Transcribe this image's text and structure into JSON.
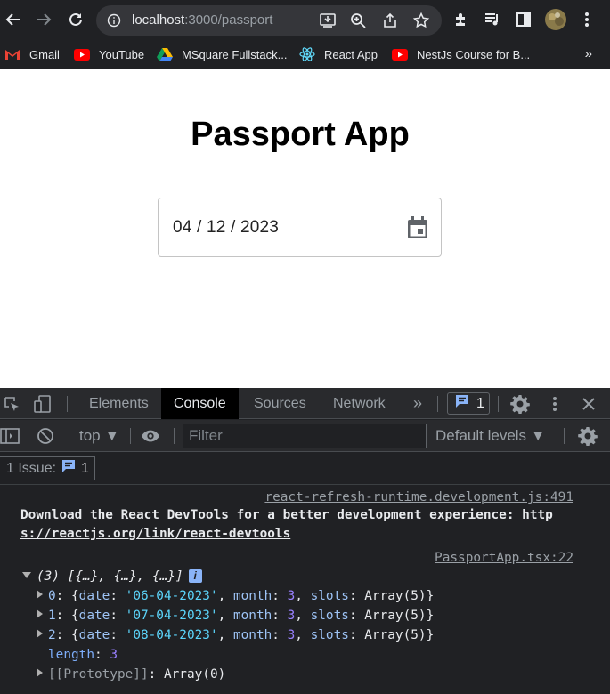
{
  "browser": {
    "url_host": "localhost",
    "url_path": ":3000/passport",
    "bookmarks": [
      {
        "label": "Gmail",
        "icon": "gmail-icon"
      },
      {
        "label": "YouTube",
        "icon": "youtube-icon"
      },
      {
        "label": "MSquare Fullstack...",
        "icon": "drive-icon"
      },
      {
        "label": "React App",
        "icon": "react-icon"
      },
      {
        "label": "NestJs Course for B...",
        "icon": "youtube-icon"
      }
    ],
    "bookmarks_more": "»"
  },
  "page": {
    "title": "Passport App",
    "date_value": "04 / 12 / 2023"
  },
  "devtools": {
    "tabs": [
      "Elements",
      "Console",
      "Sources",
      "Network"
    ],
    "active_tab": "Console",
    "more_tabs": "»",
    "issues_count": "1",
    "context": "top ▼",
    "filter_placeholder": "Filter",
    "levels": "Default levels ▼",
    "issue_label": "1 Issue:",
    "issue_count": "1",
    "console": {
      "msg1_source": "react-refresh-runtime.development.js:491",
      "msg1_text_a": "Download the React DevTools for a better development experience: ",
      "msg1_link_a": "http",
      "msg1_link_b": "s://reactjs.org/link/react-devtools",
      "msg2_source": "PassportApp.tsx:22",
      "array_summary": "(3) [{…}, {…}, {…}]",
      "rows": [
        {
          "index": "0",
          "date": "'06-04-2023'",
          "month": "3",
          "slots": "Array(5)"
        },
        {
          "index": "1",
          "date": "'07-04-2023'",
          "month": "3",
          "slots": "Array(5)"
        },
        {
          "index": "2",
          "date": "'08-04-2023'",
          "month": "3",
          "slots": "Array(5)"
        }
      ],
      "length_label": "length",
      "length_value": "3",
      "prototype_label": "[[Prototype]]",
      "prototype_value": "Array(0)"
    }
  }
}
